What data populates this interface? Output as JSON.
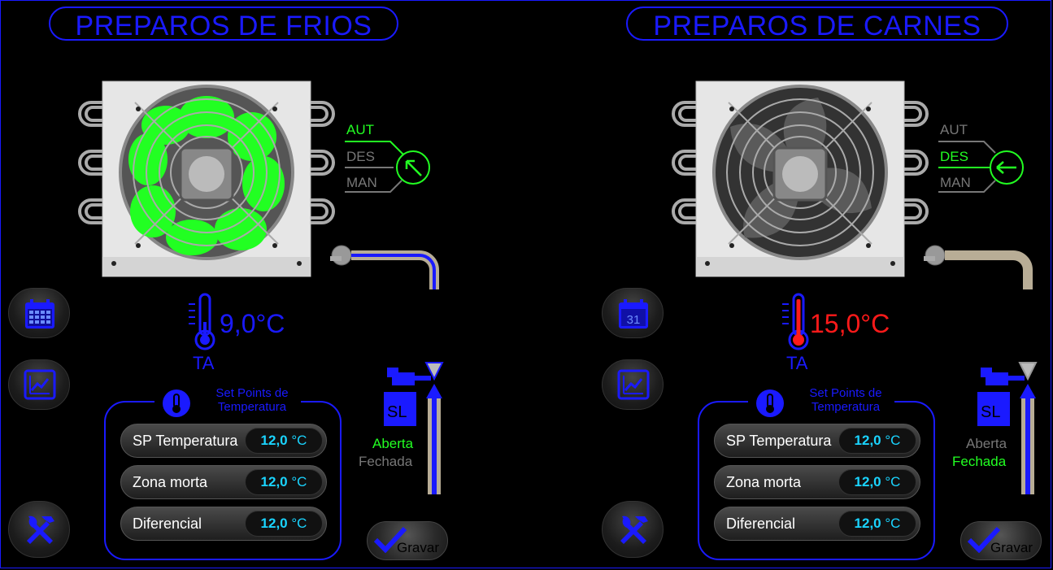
{
  "panels": [
    {
      "title": "PREPAROS DE FRIOS",
      "temp_value": "9,0°C",
      "temp_color": "#1a1aff",
      "temp_label": "TA",
      "fan_state": "running",
      "fan_color": "#22ff22",
      "mode_options": [
        "AUT",
        "DES",
        "MAN"
      ],
      "mode_active": "AUT",
      "valve_open_label": "Aberta",
      "valve_closed_label": "Fechada",
      "valve_state": "Aberta",
      "valve_tag": "SL",
      "setpoints_title": "Set Points de Temperatura",
      "setpoints": [
        {
          "label": "SP Temperatura",
          "value": "12,0",
          "unit": "°C"
        },
        {
          "label": "Zona morta",
          "value": "12,0",
          "unit": "°C"
        },
        {
          "label": "Diferencial",
          "value": "12,0",
          "unit": "°C"
        }
      ],
      "save_label": "Gravar",
      "calendar_icon": "calendar-grid-icon"
    },
    {
      "title": "PREPAROS DE CARNES",
      "temp_value": "15,0°C",
      "temp_color": "#ff1a1a",
      "temp_label": "TA",
      "fan_state": "stopped",
      "fan_color": "#555555",
      "mode_options": [
        "AUT",
        "DES",
        "MAN"
      ],
      "mode_active": "DES",
      "valve_open_label": "Aberta",
      "valve_closed_label": "Fechada",
      "valve_state": "Fechada",
      "valve_tag": "SL",
      "setpoints_title": "Set Points de Temperatura",
      "setpoints": [
        {
          "label": "SP Temperatura",
          "value": "12,0",
          "unit": "°C"
        },
        {
          "label": "Zona morta",
          "value": "12,0",
          "unit": "°C"
        },
        {
          "label": "Diferencial",
          "value": "12,0",
          "unit": "°C"
        }
      ],
      "save_label": "Gravar",
      "calendar_day": "31"
    }
  ],
  "colors": {
    "accent": "#1a1aff",
    "active": "#22ff22",
    "inactive": "#777777",
    "value": "#1ad4ff",
    "alarm": "#ff1a1a"
  }
}
